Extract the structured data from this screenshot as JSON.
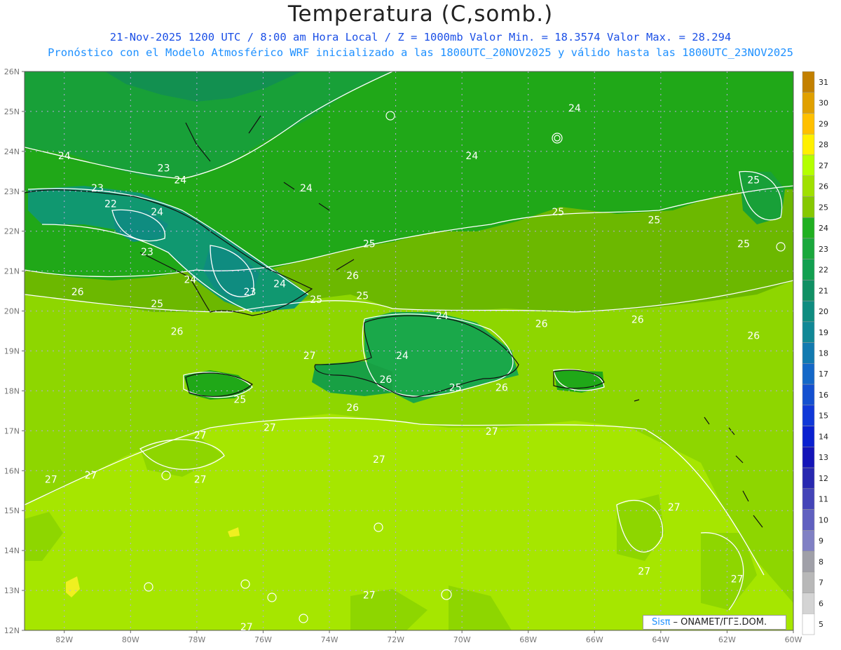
{
  "title": "Temperatura (C,somb.)",
  "subtitle_line1": "21-Nov-2025  1200 UTC / 8:00 am Hora Local / Z = 1000mb    Valor Min. = 18.3574  Valor Max. = 28.294",
  "subtitle_line2": "Pronóstico con el Modelo Atmosférico WRF inicializado a las 1800UTC_20NOV2025 y válido hasta las  1800UTC_23NOV2025",
  "map": {
    "lat_labels": [
      "26N",
      "25N",
      "24N",
      "23N",
      "22N",
      "21N",
      "20N",
      "19N",
      "18N",
      "17N",
      "16N",
      "15N",
      "14N",
      "13N",
      "12N"
    ],
    "lon_labels": [
      "82W",
      "80W",
      "78W",
      "76W",
      "74W",
      "72W",
      "70W",
      "68W",
      "66W",
      "64W",
      "62W",
      "60W"
    ],
    "contour_labels": [
      {
        "text": "24",
        "lon": -82.0,
        "lat": 23.8
      },
      {
        "text": "23",
        "lon": -79.0,
        "lat": 23.5
      },
      {
        "text": "24",
        "lon": -78.5,
        "lat": 23.2
      },
      {
        "text": "23",
        "lon": -81.0,
        "lat": 23.0
      },
      {
        "text": "22",
        "lon": -80.6,
        "lat": 22.6
      },
      {
        "text": "24",
        "lon": -79.2,
        "lat": 22.4
      },
      {
        "text": "24",
        "lon": -74.7,
        "lat": 23.0
      },
      {
        "text": "24",
        "lon": -69.7,
        "lat": 23.8
      },
      {
        "text": "24",
        "lon": -66.6,
        "lat": 25.0
      },
      {
        "text": "25",
        "lon": -67.1,
        "lat": 22.4
      },
      {
        "text": "25",
        "lon": -64.2,
        "lat": 22.2
      },
      {
        "text": "25",
        "lon": -61.2,
        "lat": 23.2
      },
      {
        "text": "25",
        "lon": -61.5,
        "lat": 21.6
      },
      {
        "text": "25",
        "lon": -72.8,
        "lat": 21.6
      },
      {
        "text": "23",
        "lon": -79.5,
        "lat": 21.4
      },
      {
        "text": "24",
        "lon": -78.2,
        "lat": 20.7
      },
      {
        "text": "25",
        "lon": -79.2,
        "lat": 20.1
      },
      {
        "text": "23",
        "lon": -76.4,
        "lat": 20.4
      },
      {
        "text": "24",
        "lon": -75.5,
        "lat": 20.6
      },
      {
        "text": "25",
        "lon": -74.4,
        "lat": 20.2
      },
      {
        "text": "26",
        "lon": -73.3,
        "lat": 20.8
      },
      {
        "text": "25",
        "lon": -73.0,
        "lat": 20.3
      },
      {
        "text": "26",
        "lon": -81.6,
        "lat": 20.4
      },
      {
        "text": "26",
        "lon": -78.6,
        "lat": 19.4
      },
      {
        "text": "24",
        "lon": -70.6,
        "lat": 19.8
      },
      {
        "text": "24",
        "lon": -71.8,
        "lat": 18.8
      },
      {
        "text": "26",
        "lon": -72.3,
        "lat": 18.2
      },
      {
        "text": "25",
        "lon": -70.2,
        "lat": 18.0
      },
      {
        "text": "26",
        "lon": -68.8,
        "lat": 18.0
      },
      {
        "text": "26",
        "lon": -67.6,
        "lat": 19.6
      },
      {
        "text": "26",
        "lon": -64.7,
        "lat": 19.7
      },
      {
        "text": "26",
        "lon": -61.2,
        "lat": 19.3
      },
      {
        "text": "27",
        "lon": -74.6,
        "lat": 18.8
      },
      {
        "text": "26",
        "lon": -73.3,
        "lat": 17.5
      },
      {
        "text": "25",
        "lon": -76.7,
        "lat": 17.7
      },
      {
        "text": "27",
        "lon": -75.8,
        "lat": 17.0
      },
      {
        "text": "27",
        "lon": -77.9,
        "lat": 16.8
      },
      {
        "text": "27",
        "lon": -69.1,
        "lat": 16.9
      },
      {
        "text": "27",
        "lon": -72.5,
        "lat": 16.2
      },
      {
        "text": "27",
        "lon": -82.4,
        "lat": 15.7
      },
      {
        "text": "27",
        "lon": -81.2,
        "lat": 15.8
      },
      {
        "text": "27",
        "lon": -77.9,
        "lat": 15.7
      },
      {
        "text": "27",
        "lon": -63.6,
        "lat": 15.0
      },
      {
        "text": "27",
        "lon": -64.5,
        "lat": 13.4
      },
      {
        "text": "27",
        "lon": -61.7,
        "lat": 13.2
      },
      {
        "text": "27",
        "lon": -72.8,
        "lat": 12.8
      },
      {
        "text": "27",
        "lon": -76.5,
        "lat": 12.0
      }
    ]
  },
  "colorbar": {
    "labels": [
      "31",
      "30",
      "29",
      "28",
      "27",
      "26",
      "25",
      "24",
      "23",
      "22",
      "21",
      "20",
      "19",
      "18",
      "17",
      "16",
      "15",
      "14",
      "13",
      "12",
      "11",
      "10",
      "9",
      "8",
      "7",
      "6",
      "5"
    ],
    "colors": [
      "#c38000",
      "#e0a000",
      "#ffc000",
      "#fff000",
      "#b4ff00",
      "#a0e000",
      "#86c800",
      "#20b020",
      "#1aa83c",
      "#12a050",
      "#109064",
      "#0f8c80",
      "#118896",
      "#127ab0",
      "#1468c8",
      "#1450d0",
      "#1038d8",
      "#0a20d0",
      "#1414b8",
      "#2828b0",
      "#4444b8",
      "#6060c0",
      "#8080c4",
      "#a0a0a8",
      "#b8b8b8",
      "#d4d4d4",
      "#ffffff"
    ]
  },
  "credit": {
    "brand": "Sisπ",
    "text": "– ONAMET/ΓΓΞ.DOM."
  }
}
